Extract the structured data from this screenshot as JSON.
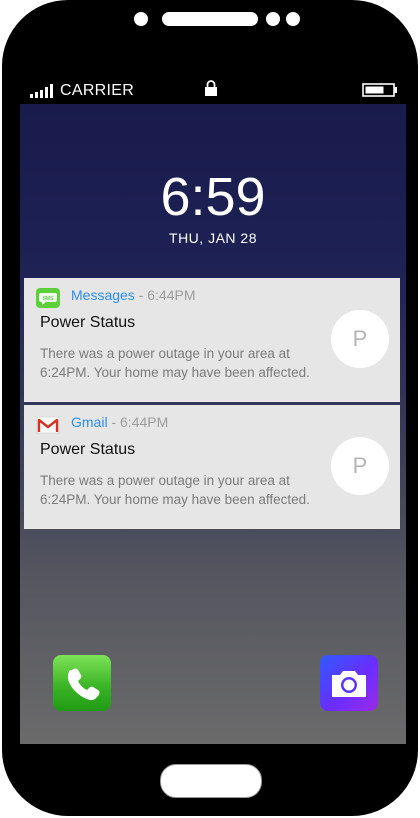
{
  "statusbar": {
    "carrier": "CARRIER",
    "signal_icon": "signal-bars-icon",
    "lock_icon": "lock-icon",
    "battery_icon": "battery-icon"
  },
  "lockscreen": {
    "time": "6:59",
    "date": "THU, JAN 28"
  },
  "notifications": [
    {
      "app": "Messages",
      "app_icon": "sms-icon",
      "separator": "-",
      "time": "6:44PM",
      "title": "Power Status",
      "body": "There was a power outage in your area at 6:24PM. Your home may have been affected.",
      "avatar_initial": "P"
    },
    {
      "app": "Gmail",
      "app_icon": "gmail-icon",
      "separator": "-",
      "time": "6:44PM",
      "title": "Power Status",
      "body": "There was a power outage in your area at 6:24PM. Your home may have been affected.",
      "avatar_initial": "P"
    }
  ],
  "dock": {
    "left_app_icon": "phone-icon",
    "right_app_icon": "camera-icon"
  },
  "colors": {
    "app_name": "#2b8ee8",
    "notification_bg": "#e6e6e6",
    "phone_green": "#3cb526",
    "camera_purple": "#6a2dff"
  }
}
